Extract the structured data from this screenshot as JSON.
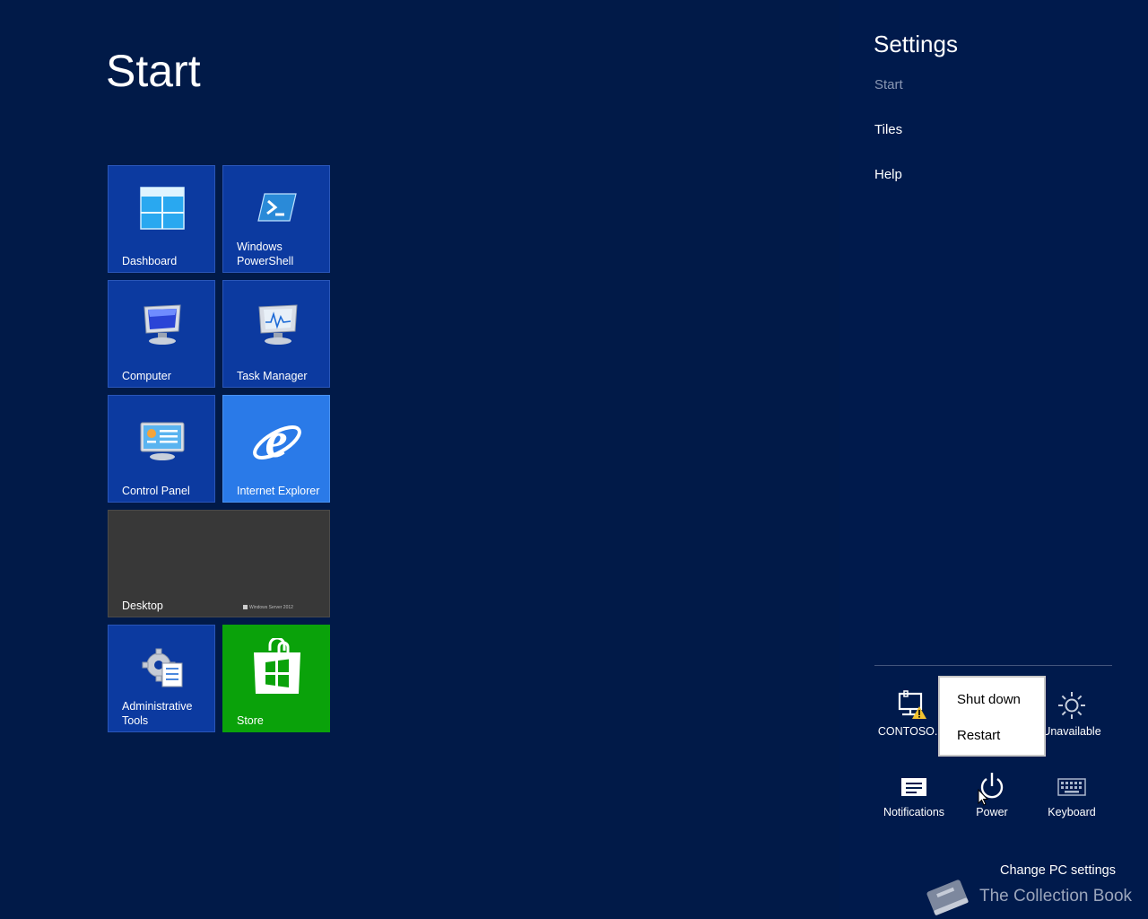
{
  "start": {
    "title": "Start"
  },
  "tiles": {
    "dashboard": "Dashboard",
    "powershell_line1": "Windows",
    "powershell_line2": "PowerShell",
    "computer": "Computer",
    "task_manager": "Task Manager",
    "control_panel": "Control Panel",
    "internet_explorer": "Internet Explorer",
    "desktop": "Desktop",
    "desktop_watermark": "Windows Server 2012",
    "admin_tools_line1": "Administrative",
    "admin_tools_line2": "Tools",
    "store": "Store"
  },
  "settings": {
    "title": "Settings",
    "links": [
      "Start",
      "Tiles",
      "Help"
    ],
    "quick": {
      "network": "CONTOSO.lo",
      "brightness": "Unavailable",
      "notifications": "Notifications",
      "power": "Power",
      "keyboard": "Keyboard"
    },
    "power_menu": [
      "Shut down",
      "Restart"
    ],
    "change_pc_settings": "Change PC settings"
  },
  "watermark": {
    "text": "The Collection Book"
  },
  "colors": {
    "background": "#011a48",
    "tile_blue": "#0c3aa0",
    "ie_tile": "#2a7ae8",
    "store_tile": "#0aa20a",
    "desktop_tile": "#383838"
  }
}
